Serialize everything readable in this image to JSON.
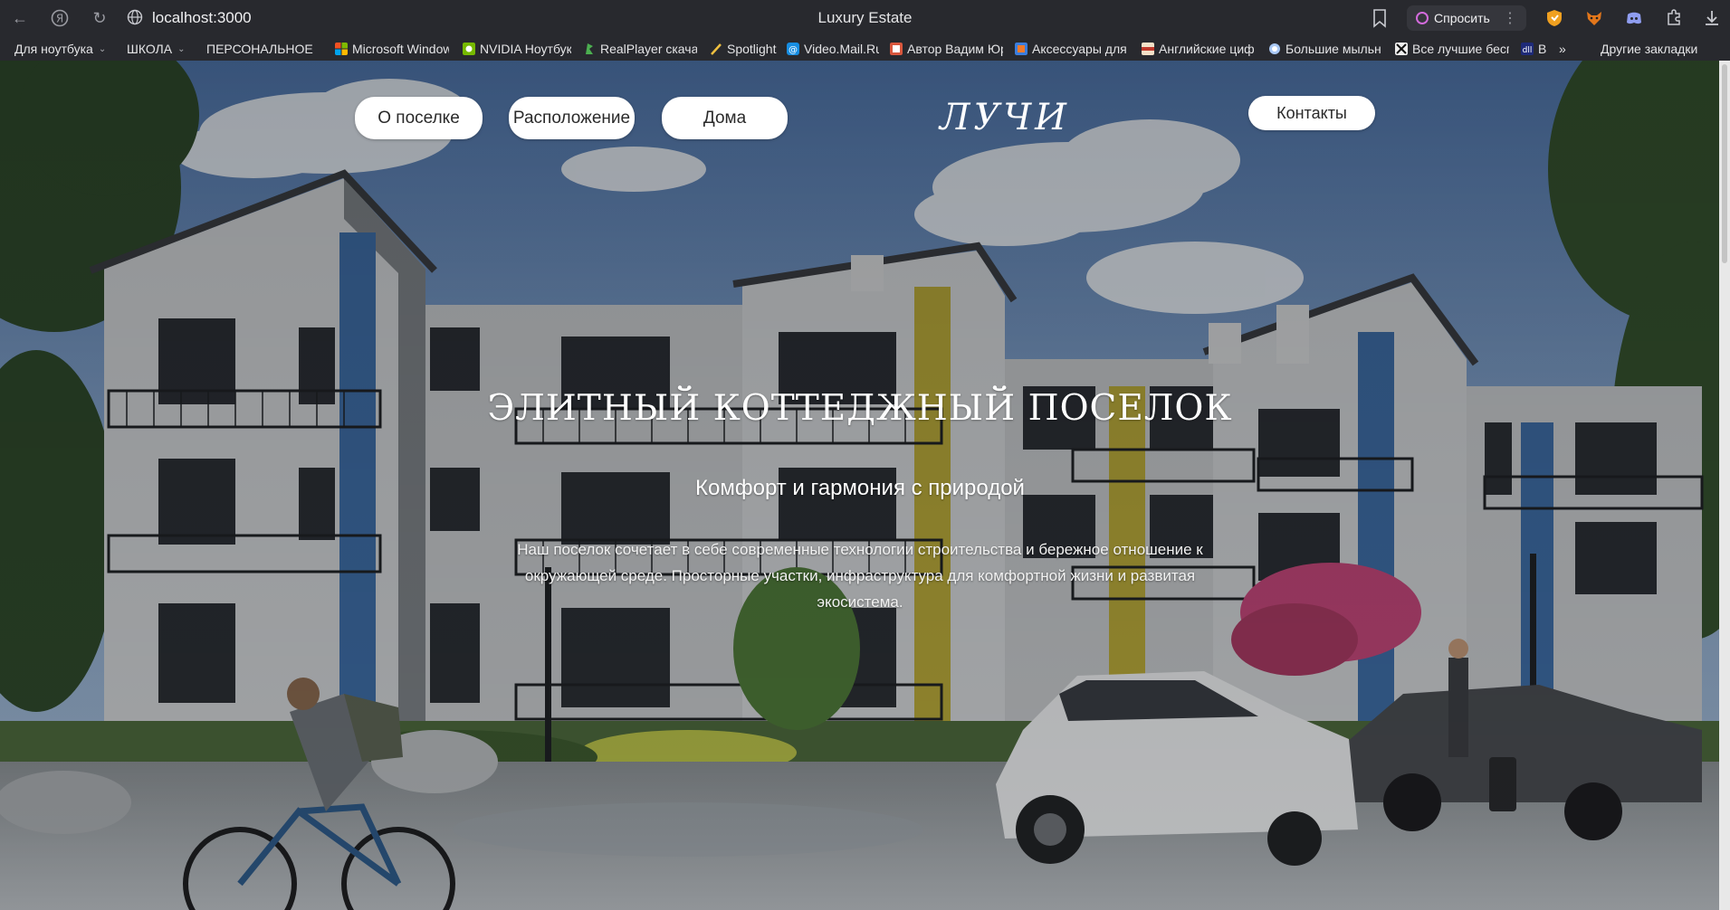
{
  "browser": {
    "window_title": "Luxury Estate",
    "url": "localhost:3000",
    "ask_button_label": "Спросить",
    "icons": [
      "back-icon",
      "yandex-icon",
      "reload-icon",
      "globe-icon",
      "bookmark-icon",
      "kebab-icon",
      "shield-extension-icon",
      "fox-extension-icon",
      "discord-extension-icon",
      "extensions-icon",
      "download-icon"
    ]
  },
  "bookmarks": {
    "items": [
      {
        "label": "Для ноутбука",
        "folder": true
      },
      {
        "label": "ШКОЛА",
        "folder": true
      },
      {
        "label": "ПЕРСОНАЛЬНОЕ",
        "folder": true
      },
      {
        "label": "Microsoft Window"
      },
      {
        "label": "NVIDIA Ноутбук."
      },
      {
        "label": "RealPlayer скачат"
      },
      {
        "label": "Spotlight"
      },
      {
        "label": "Video.Mail.Ru"
      },
      {
        "label": "Автор Вадим Юр"
      },
      {
        "label": "Аксессуары для с"
      },
      {
        "label": "Английские циф"
      },
      {
        "label": "Большие мыльн"
      },
      {
        "label": "Все лучшие бесп"
      },
      {
        "label": "В"
      }
    ],
    "overflow_label": "»",
    "other_label": "Другие закладки"
  },
  "site": {
    "nav": {
      "about": "О поселке",
      "location": "Расположение",
      "houses": "Дома",
      "contacts": "Контакты"
    },
    "logo": "ЛУЧИ",
    "hero": {
      "title": "ЭЛИТНЫЙ КОТТЕДЖНЫЙ ПОСЕЛОК",
      "subtitle": "Комфорт и гармония с природой",
      "description": "Наш поселок сочетает в себе современные технологии строительства и бережное отношение к окружающей среде. Просторные участки, инфраструктура для комфортной жизни и развитая экосистема."
    }
  },
  "colors": {
    "browser_bg": "#28292e",
    "nav_pill_bg": "#ffffff",
    "accent_blue": "#3e6da6",
    "accent_yellow": "#b8a93a"
  }
}
